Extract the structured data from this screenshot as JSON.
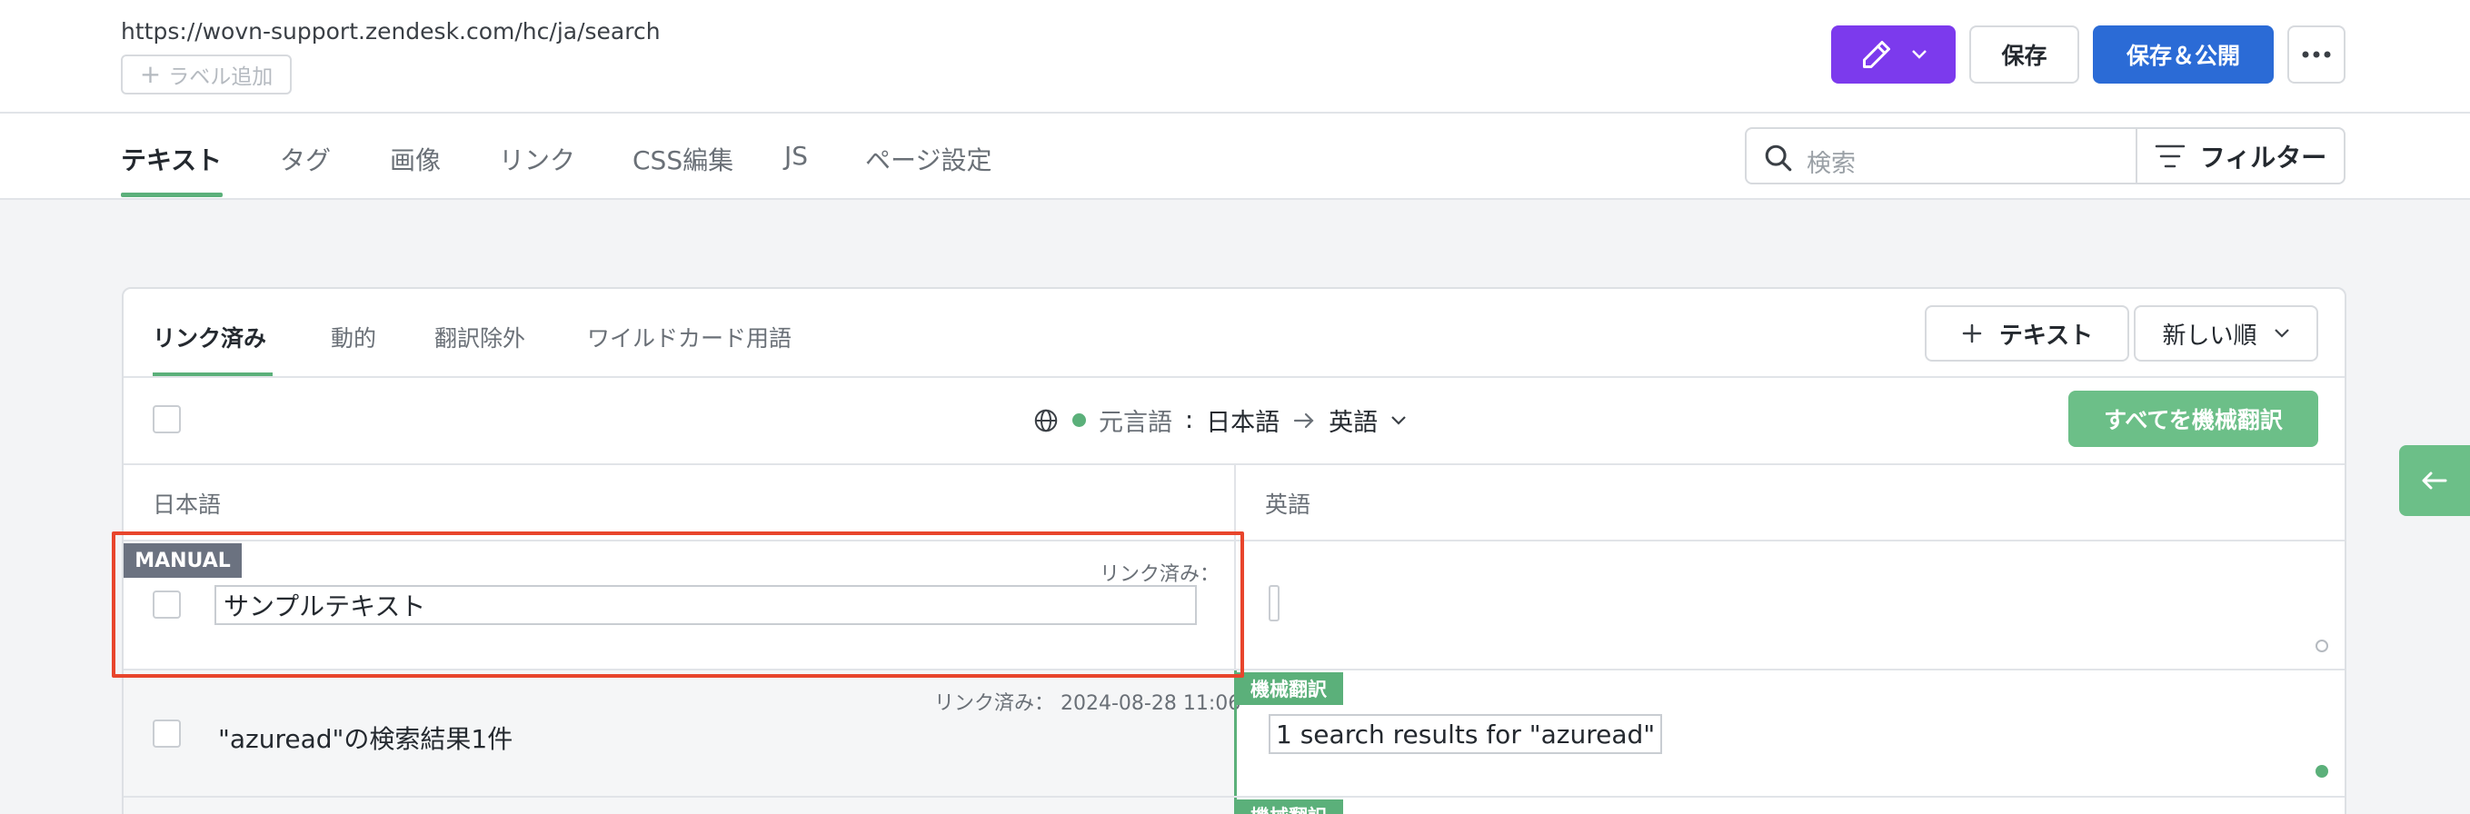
{
  "header": {
    "url": "https://wovn-support.zendesk.com/hc/ja/search",
    "label_add": "ラベル追加",
    "save_label": "保存",
    "publish_label": "保存＆公開"
  },
  "main_tabs": [
    {
      "label": "テキスト",
      "active": true
    },
    {
      "label": "タグ"
    },
    {
      "label": "画像"
    },
    {
      "label": "リンク"
    },
    {
      "label": "CSS編集"
    },
    {
      "label": "JS"
    },
    {
      "label": "ページ設定"
    }
  ],
  "search": {
    "placeholder": "検索"
  },
  "filter_label": "フィルター",
  "sub_tabs": [
    {
      "label": "リンク済み",
      "active": true
    },
    {
      "label": "動的"
    },
    {
      "label": "翻訳除外"
    },
    {
      "label": "ワイルドカード用語"
    }
  ],
  "add_text_label": "テキスト",
  "sort_label": "新しい順",
  "language": {
    "source_prefix": "元言語",
    "source": "日本語",
    "target": "英語"
  },
  "machine_translate_all": "すべてを機械翻訳",
  "columns": {
    "source": "日本語",
    "target": "英語"
  },
  "rows": [
    {
      "badge": "MANUAL",
      "linked_label": "リンク済み：",
      "source_text": "サンプルテキスト",
      "translation": ""
    },
    {
      "linked_label": "リンク済み： 2024-08-28 11:06",
      "source_text": "\"azuread\"の検索結果1件",
      "mt_badge": "機械翻訳",
      "translation": "1 search results for \"azuread\""
    },
    {
      "mt_badge": "機械翻訳"
    }
  ],
  "colors": {
    "accent_green": "#5bb07a",
    "primary_blue": "#2b6bd6",
    "edit_purple": "#7c3aed",
    "highlight_red": "#e8452c"
  }
}
